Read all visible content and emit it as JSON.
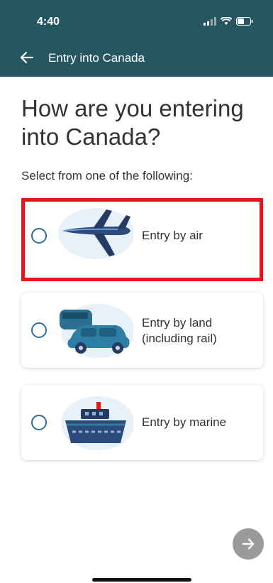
{
  "status_bar": {
    "time": "4:40"
  },
  "header": {
    "title": "Entry into Canada"
  },
  "page": {
    "title": "How are you entering into Canada?",
    "subtitle": "Select from one of the following:"
  },
  "options": [
    {
      "label": "Entry by air",
      "selected": true,
      "illustration": "airplane-icon"
    },
    {
      "label": "Entry by land (including rail)",
      "selected": false,
      "illustration": "car-train-icon"
    },
    {
      "label": "Entry by marine",
      "selected": false,
      "illustration": "ship-icon"
    }
  ],
  "colors": {
    "header": "#26565f",
    "highlight": "#e4161b",
    "radio": "#2a6f97",
    "next_button": "#9a9a9a"
  }
}
